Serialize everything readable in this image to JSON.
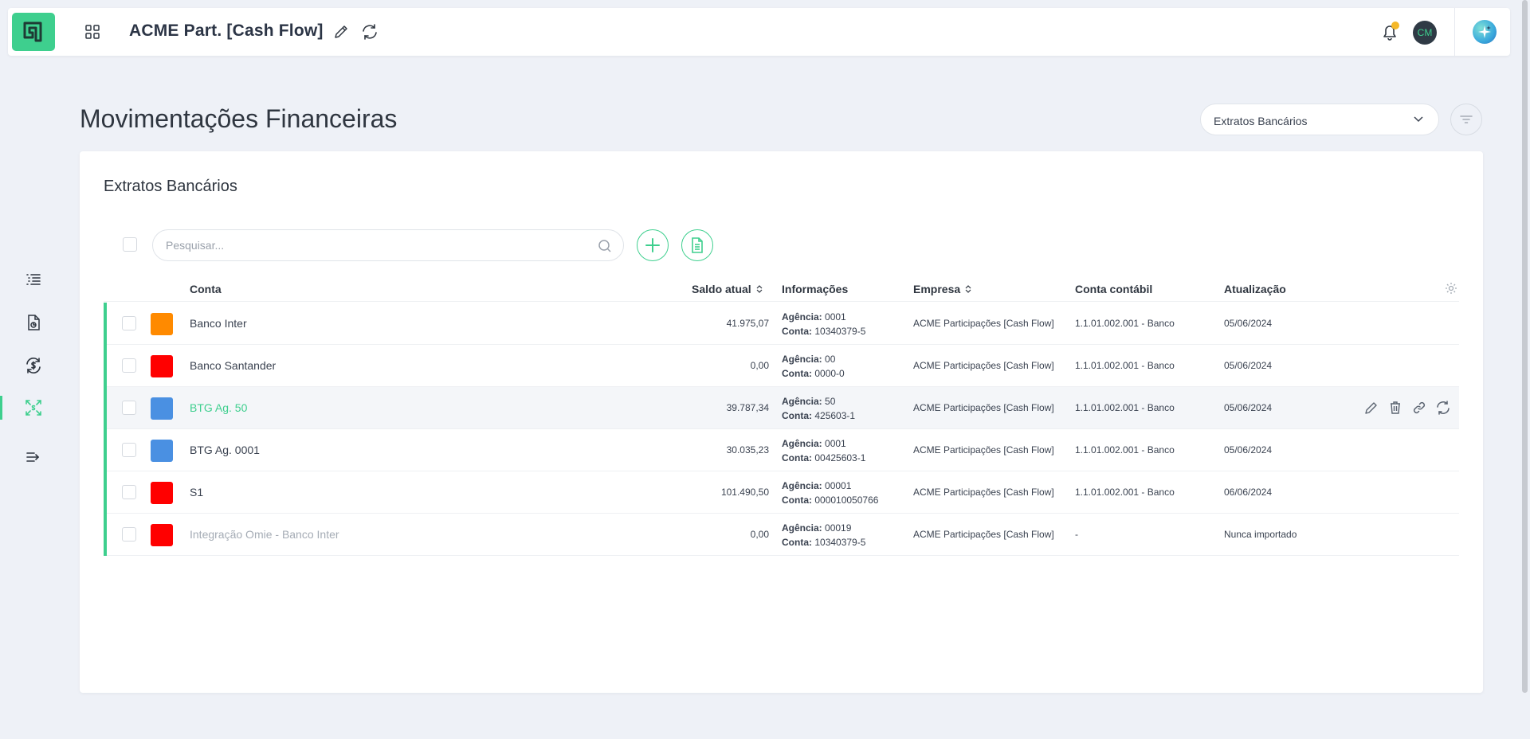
{
  "header": {
    "app_title": "ACME Part. [Cash Flow]",
    "user_initials": "CM"
  },
  "page": {
    "title": "Movimentações Financeiras",
    "view_select": "Extratos Bancários"
  },
  "card": {
    "title": "Extratos Bancários",
    "search_placeholder": "Pesquisar..."
  },
  "table": {
    "columns": {
      "conta": "Conta",
      "saldo": "Saldo atual",
      "info": "Informações",
      "empresa": "Empresa",
      "conta_contabil": "Conta contábil",
      "atualizacao": "Atualização"
    },
    "info_labels": {
      "agencia": "Agência:",
      "conta": "Conta:"
    },
    "rows": [
      {
        "name": "Banco Inter",
        "color": "#ff8a00",
        "saldo": "41.975,07",
        "agencia": "0001",
        "conta": "10340379-5",
        "empresa": "ACME Participações [Cash Flow]",
        "conta_contabil": "1.1.01.002.001 - Banco",
        "atualizacao": "05/06/2024"
      },
      {
        "name": "Banco Santander",
        "color": "#ff0000",
        "saldo": "0,00",
        "agencia": "00",
        "conta": "0000-0",
        "empresa": "ACME Participações [Cash Flow]",
        "conta_contabil": "1.1.01.002.001 - Banco",
        "atualizacao": "05/06/2024"
      },
      {
        "name": "BTG Ag. 50",
        "color": "#4a90e2",
        "saldo": "39.787,34",
        "agencia": "50",
        "conta": "425603-1",
        "empresa": "ACME Participações [Cash Flow]",
        "conta_contabil": "1.1.01.002.001 - Banco",
        "atualizacao": "05/06/2024"
      },
      {
        "name": "BTG Ag. 0001",
        "color": "#4a90e2",
        "saldo": "30.035,23",
        "agencia": "0001",
        "conta": "00425603-1",
        "empresa": "ACME Participações [Cash Flow]",
        "conta_contabil": "1.1.01.002.001 - Banco",
        "atualizacao": "05/06/2024"
      },
      {
        "name": "S1",
        "color": "#ff0000",
        "saldo": "101.490,50",
        "agencia": "00001",
        "conta": "000010050766",
        "empresa": "ACME Participações [Cash Flow]",
        "conta_contabil": "1.1.01.002.001 - Banco",
        "atualizacao": "06/06/2024"
      },
      {
        "name": "Integração Omie - Banco Inter",
        "color": "#ff0000",
        "saldo": "0,00",
        "agencia": "00019",
        "conta": "10340379-5",
        "empresa": "ACME Participações [Cash Flow]",
        "conta_contabil": "-",
        "atualizacao": "Nunca importado"
      }
    ]
  },
  "colors": {
    "accent": "#3ecf8e",
    "background": "#eef1f7"
  },
  "icons": {
    "sidenav": [
      "list-icon",
      "report-icon",
      "currency-exchange-icon",
      "reconcile-icon",
      "collapse-menu-icon"
    ],
    "row_actions": [
      "edit-icon",
      "trash-icon",
      "link-icon",
      "refresh-icon"
    ]
  }
}
